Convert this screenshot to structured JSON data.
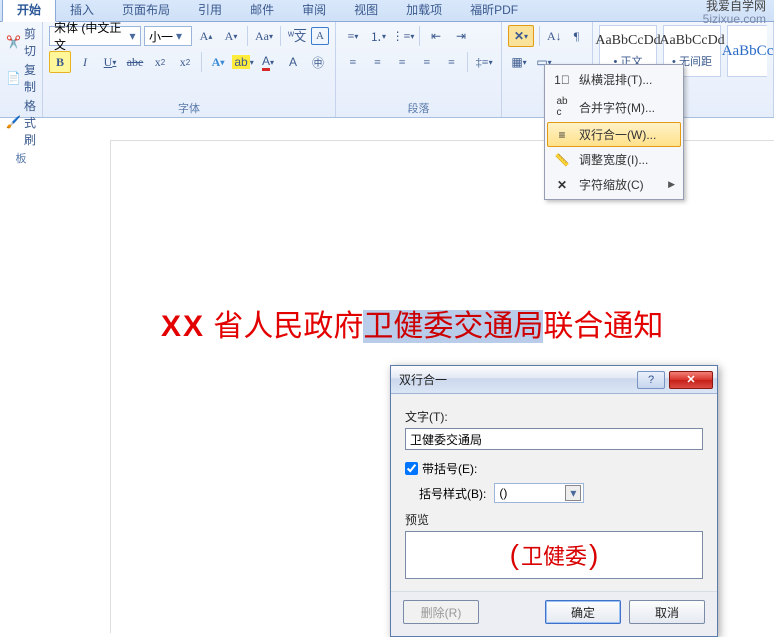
{
  "brand": {
    "line1": "我爱自学网",
    "line2": "5izixue.com"
  },
  "tabs": [
    "开始",
    "插入",
    "页面布局",
    "引用",
    "邮件",
    "审阅",
    "视图",
    "加载项",
    "福昕PDF"
  ],
  "activeTab": 0,
  "clipboard": {
    "cut": "剪切",
    "copy": "复制",
    "format": "格式刷",
    "label": "板"
  },
  "font": {
    "family": "宋体 (中文正文",
    "size": "小一",
    "group_label": "字体"
  },
  "paragraph": {
    "group_label": "段落"
  },
  "styles": {
    "s1_sample": "AaBbCcDd",
    "s1_label": "• 正文",
    "s2_sample": "AaBbCcDd",
    "s2_label": "• 无间距",
    "s3_sample": "AaBbCc"
  },
  "dropdown": {
    "m1": "纵横混排(T)...",
    "m2": "合并字符(M)...",
    "m3": "双行合一(W)...",
    "m4": "调整宽度(I)...",
    "m5": "字符缩放(C)"
  },
  "doc": {
    "t1": "XX",
    "t2": " 省人民政府",
    "sel": "卫健委交通局",
    "t3": "联合通知"
  },
  "dialog": {
    "title": "双行合一",
    "text_label": "文字(T):",
    "text_value": "卫健委交通局",
    "bracket_chk": "带括号(E):",
    "bracket_style_label": "括号样式(B):",
    "bracket_style_value": "()",
    "preview_label": "预览",
    "preview_text": "卫健委",
    "remove": "删除(R)",
    "ok": "确定",
    "cancel": "取消"
  }
}
